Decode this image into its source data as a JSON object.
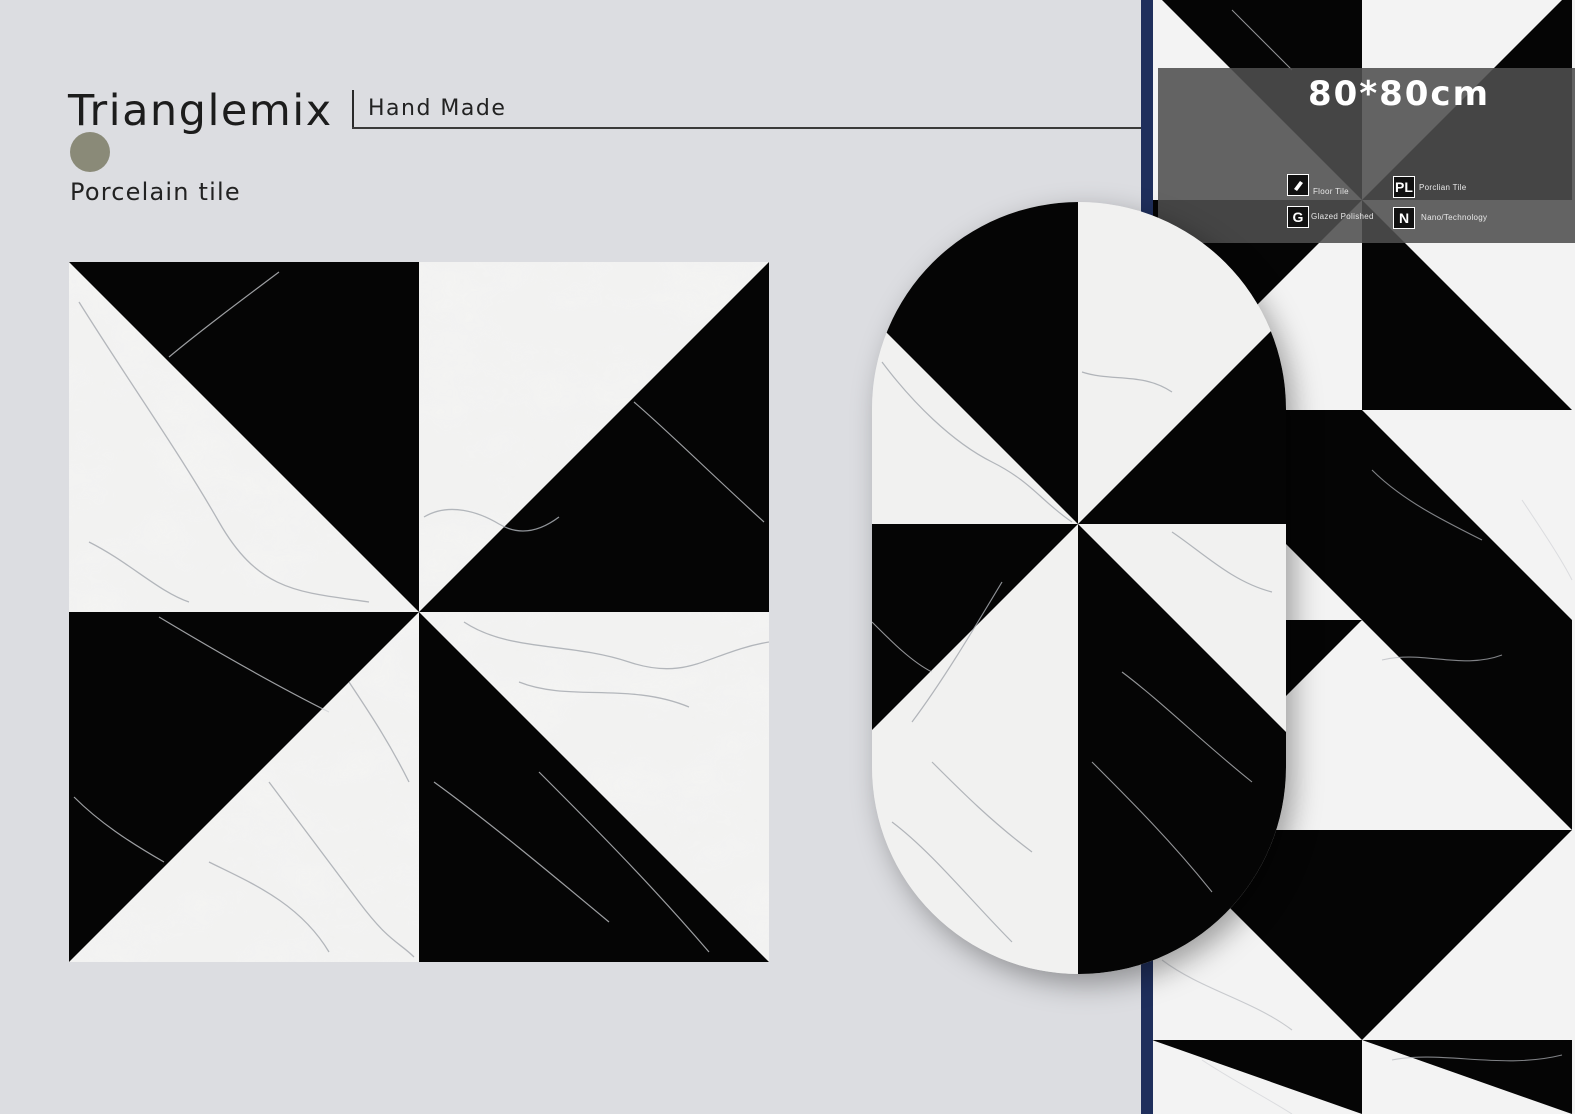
{
  "header": {
    "title": "Trianglemix",
    "subtitle": "Hand Made",
    "material": "Porcelain tile"
  },
  "colors": {
    "swatch": "#8a8a78",
    "black": "#050505",
    "marble": "#f2f2f1",
    "panel_edge": "#1f2f5c"
  },
  "spec": {
    "size": "80*80cm",
    "features": [
      {
        "code": "",
        "icon": "floor-tile-icon",
        "label": "Floor Tile"
      },
      {
        "code": "PL",
        "icon": "porcelain-tile-icon",
        "label": "Porclian Tile"
      },
      {
        "code": "G",
        "icon": "glazed-polished-icon",
        "label": "Glazed Polished"
      },
      {
        "code": "N",
        "icon": "nano-technology-icon",
        "label": "Nano/Technology"
      }
    ]
  }
}
